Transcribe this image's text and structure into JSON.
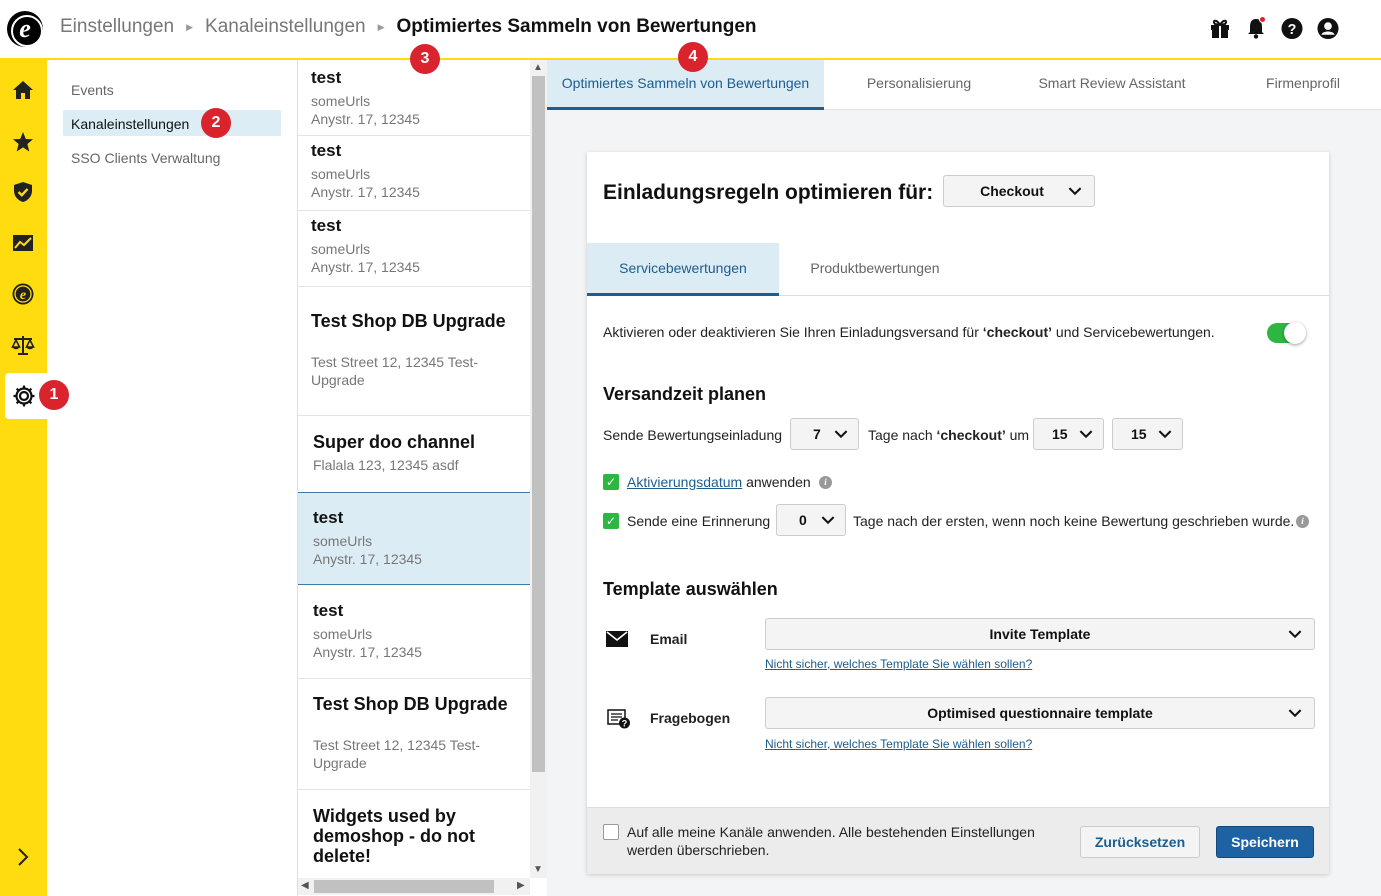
{
  "header": {
    "breadcrumbs": [
      "Einstellungen",
      "Kanaleinstellungen",
      "Optimiertes Sammeln von Bewertungen"
    ]
  },
  "markers": [
    "1",
    "2",
    "3",
    "4"
  ],
  "subnav": {
    "items": [
      "Events",
      "Kanaleinstellungen",
      "SSO Clients Verwaltung"
    ],
    "active": "Kanaleinstellungen"
  },
  "channels": [
    {
      "name": "test",
      "lines": [
        "someUrls",
        "Anystr. 17, 12345"
      ]
    },
    {
      "name": "test",
      "lines": [
        "someUrls",
        "Anystr. 17, 12345"
      ]
    },
    {
      "name": "test",
      "lines": [
        "someUrls",
        "Anystr. 17, 12345"
      ]
    },
    {
      "name": "Test Shop DB Upgrade",
      "lines": [
        "Test Street 12, 12345 Test-",
        "Upgrade"
      ]
    },
    {
      "name": "Super doo channel",
      "lines": [
        "Flalala 123, 12345 asdf"
      ]
    },
    {
      "name": "test",
      "lines": [
        "someUrls",
        "Anystr. 17, 12345"
      ],
      "selected": true
    },
    {
      "name": "test",
      "lines": [
        "someUrls",
        "Anystr. 17, 12345"
      ]
    },
    {
      "name": "Test Shop DB Upgrade",
      "lines": [
        "Test Street 12, 12345 Test-",
        "Upgrade"
      ]
    },
    {
      "name": "Widgets used by demoshop - do not delete!",
      "lines": []
    }
  ],
  "tabs": [
    "Optimiertes Sammeln von Bewertungen",
    "Personalisierung",
    "Smart Review Assistant",
    "Firmenprofil"
  ],
  "card": {
    "title": "Einladungsregeln optimieren für:",
    "optimize_for": "Checkout",
    "inner_tabs": [
      "Servicebewertungen",
      "Produktbewertungen"
    ],
    "activate_text_pre": "Aktivieren oder deaktivieren Sie Ihren Einladungsversand für ",
    "activate_text_bold": "‘checkout’",
    "activate_text_post": " und Servicebewertungen.",
    "toggle_on": true,
    "schedule_heading": "Versandzeit planen",
    "send_label": "Sende Bewertungseinladung",
    "days_value": "7",
    "days_after_pre": "Tage nach ",
    "days_after_bold": "‘checkout’",
    "days_after_post": " um",
    "hour_value": "15",
    "minute_value": "15",
    "activation_link": "Aktivierungsdatum",
    "activation_suffix": "anwenden",
    "activation_checked": true,
    "reminder_label": "Sende eine Erinnerung",
    "reminder_checked": true,
    "reminder_days": "0",
    "reminder_suffix": "Tage nach der ersten, wenn noch keine Bewertung geschrieben wurde.",
    "template_heading": "Template auswählen",
    "email_label": "Email",
    "email_template": "Invite Template",
    "questionnaire_label": "Fragebogen",
    "questionnaire_template": "Optimised questionnaire template",
    "template_help_link": "Nicht sicher, welches Template Sie wählen sollen?",
    "apply_all_text_1": "Auf alle meine Kanäle anwenden. Alle bestehenden Einstellungen",
    "apply_all_text_2": "werden überschrieben.",
    "reset_button": "Zurücksetzen",
    "save_button": "Speichern"
  },
  "colors": {
    "accent_yellow": "#ffdc0f",
    "primary_blue": "#1d63a3",
    "tab_active_bg": "#dcecf5",
    "marker_red": "#d9232d",
    "toggle_green": "#2db742"
  }
}
